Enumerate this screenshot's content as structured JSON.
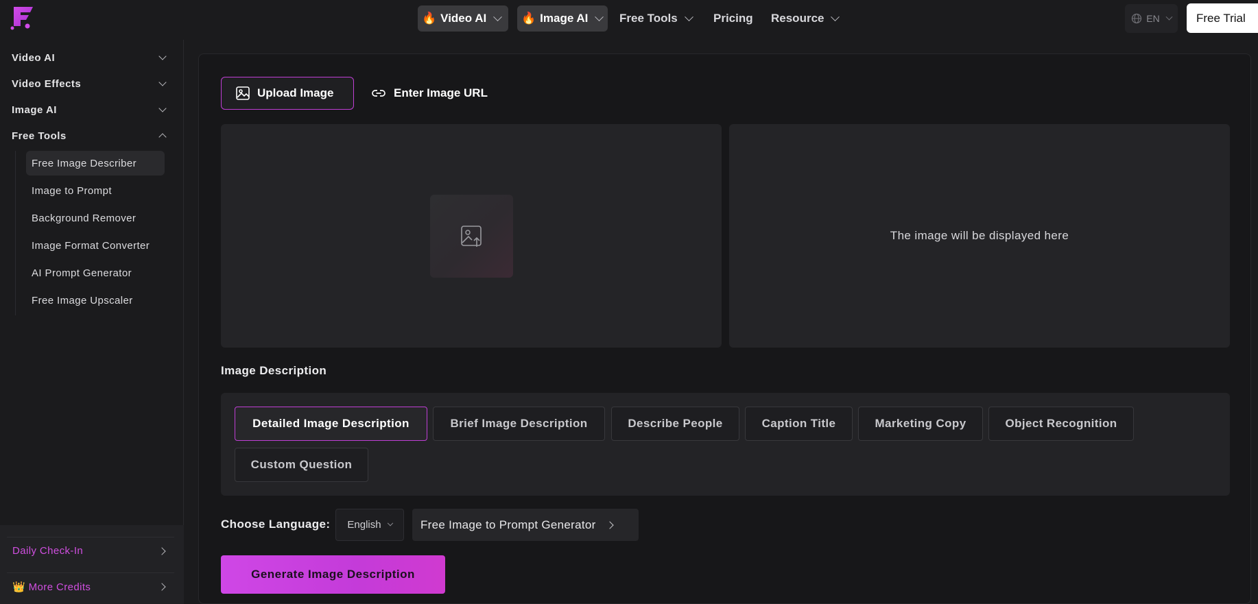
{
  "colors": {
    "accent": "#c03fd6",
    "background": "#1b1b1d",
    "panel": "#171719"
  },
  "header": {
    "nav": [
      {
        "label": "Video AI",
        "icon": "fire-icon",
        "highlighted": true
      },
      {
        "label": "Image AI",
        "icon": "fire-icon",
        "highlighted": true
      },
      {
        "label": "Free Tools",
        "icon": "",
        "highlighted": false
      },
      {
        "label": "Pricing",
        "icon": "",
        "highlighted": false
      },
      {
        "label": "Resource",
        "icon": "",
        "highlighted": false
      }
    ],
    "fire_glyph": "🔥",
    "language": "EN",
    "trial_label": "Free Trial"
  },
  "sidebar": {
    "sections": [
      {
        "label": "Video AI",
        "expanded": false
      },
      {
        "label": "Video Effects",
        "expanded": false
      },
      {
        "label": "Image AI",
        "expanded": false
      },
      {
        "label": "Free Tools",
        "expanded": true
      }
    ],
    "items": [
      {
        "label": "Free Image Describer",
        "active": true
      },
      {
        "label": "Image to Prompt",
        "active": false
      },
      {
        "label": "Background Remover",
        "active": false
      },
      {
        "label": "Image Format Converter",
        "active": false
      },
      {
        "label": "AI Prompt Generator",
        "active": false
      },
      {
        "label": "Free Image Upscaler",
        "active": false
      }
    ],
    "daily_checkin": "Daily Check-In",
    "more_credits": "More Credits",
    "crown_glyph": "👑"
  },
  "main": {
    "upload_tab": "Upload Image",
    "url_tab": "Enter Image URL",
    "preview_placeholder": "The image will be displayed here",
    "section_title": "Image Description",
    "options": [
      {
        "label": "Detailed Image Description",
        "active": true
      },
      {
        "label": "Brief Image Description",
        "active": false
      },
      {
        "label": "Describe People",
        "active": false
      },
      {
        "label": "Caption Title",
        "active": false
      },
      {
        "label": "Marketing Copy",
        "active": false
      },
      {
        "label": "Object Recognition",
        "active": false
      },
      {
        "label": "Custom Question",
        "active": false
      }
    ],
    "language_label": "Choose Language:",
    "language_value": "English",
    "prompt_generator_link": "Free Image to Prompt Generator",
    "generate_label": "Generate Image Description"
  }
}
